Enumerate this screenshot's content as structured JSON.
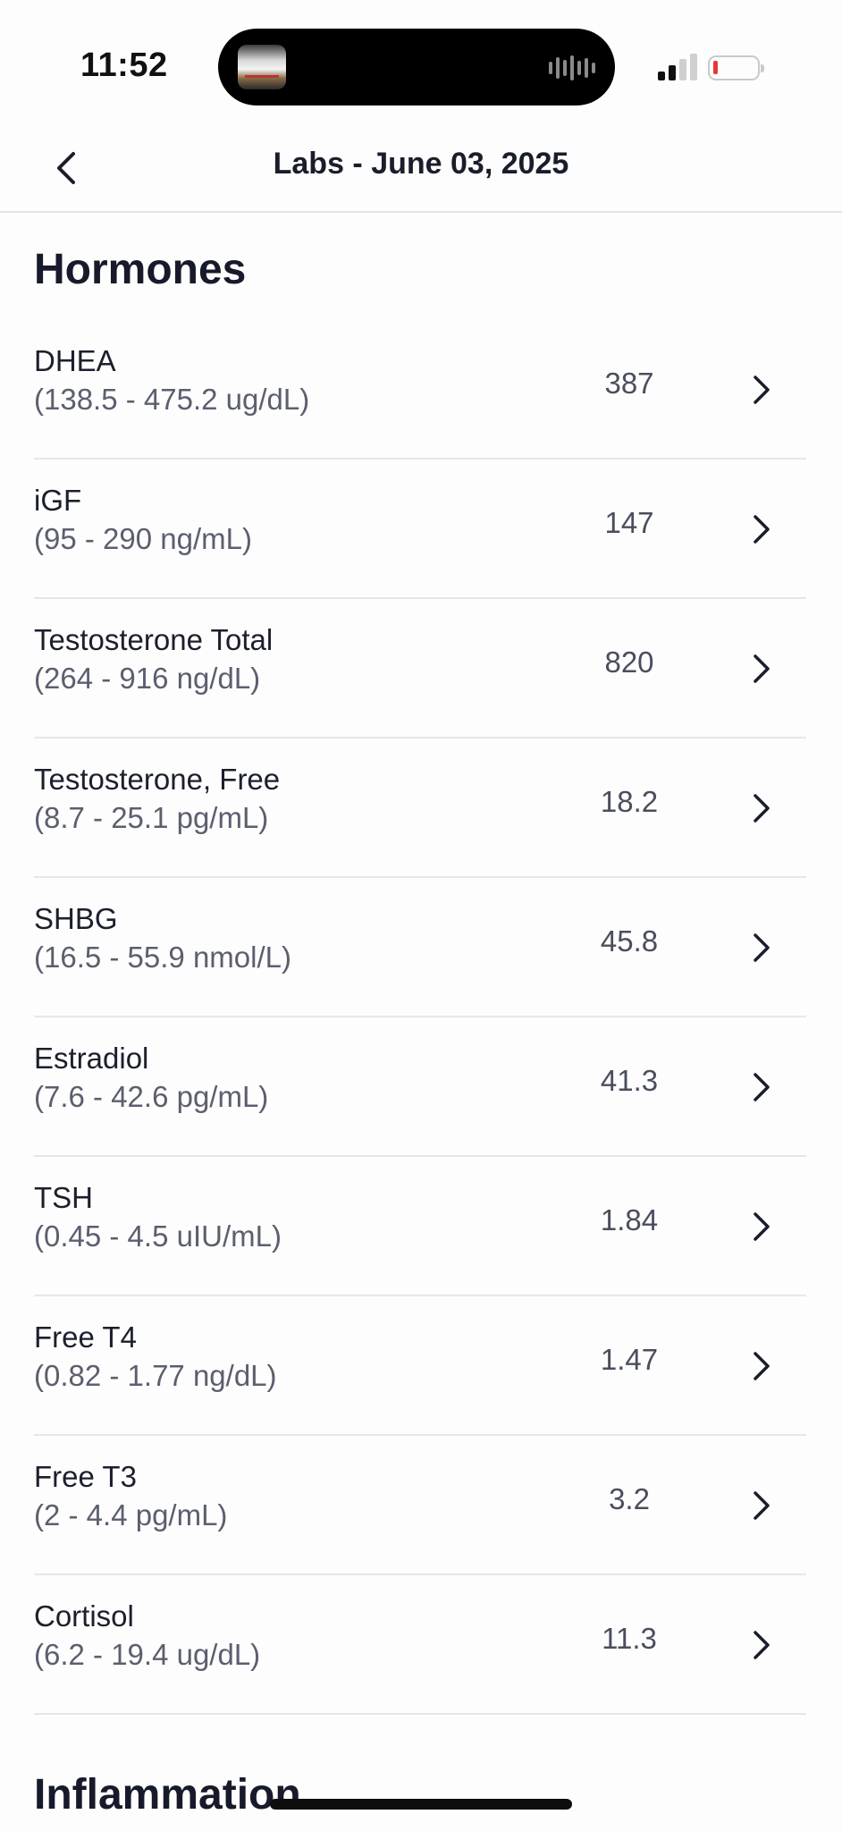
{
  "status_bar": {
    "time": "11:52"
  },
  "header": {
    "title": "Labs - June 03, 2025"
  },
  "sections": [
    {
      "title": "Hormones"
    },
    {
      "title": "Inflammation"
    }
  ],
  "labs": [
    {
      "name": "DHEA",
      "range": "(138.5 - 475.2 ug/dL)",
      "value": "387"
    },
    {
      "name": "iGF",
      "range": "(95 - 290 ng/mL)",
      "value": "147"
    },
    {
      "name": "Testosterone Total",
      "range": "(264 - 916 ng/dL)",
      "value": "820"
    },
    {
      "name": "Testosterone, Free",
      "range": "(8.7 - 25.1 pg/mL)",
      "value": "18.2"
    },
    {
      "name": "SHBG",
      "range": "(16.5 - 55.9 nmol/L)",
      "value": "45.8"
    },
    {
      "name": "Estradiol",
      "range": "(7.6 - 42.6 pg/mL)",
      "value": "41.3"
    },
    {
      "name": "TSH",
      "range": "(0.45 - 4.5 uIU/mL)",
      "value": "1.84"
    },
    {
      "name": "Free T4",
      "range": "(0.82 - 1.77 ng/dL)",
      "value": "1.47"
    },
    {
      "name": "Free T3",
      "range": "(2 - 4.4 pg/mL)",
      "value": "3.2"
    },
    {
      "name": "Cortisol",
      "range": "(6.2 - 19.4 ug/dL)",
      "value": "11.3"
    }
  ],
  "icons": {
    "back": "chevron-left-icon",
    "row": "chevron-right-icon",
    "signal": "cellular-signal-icon",
    "battery": "battery-low-icon"
  },
  "colors": {
    "battery_low": "#e53935",
    "text_primary": "#1a1d2b",
    "text_secondary": "#5b5f6e"
  }
}
